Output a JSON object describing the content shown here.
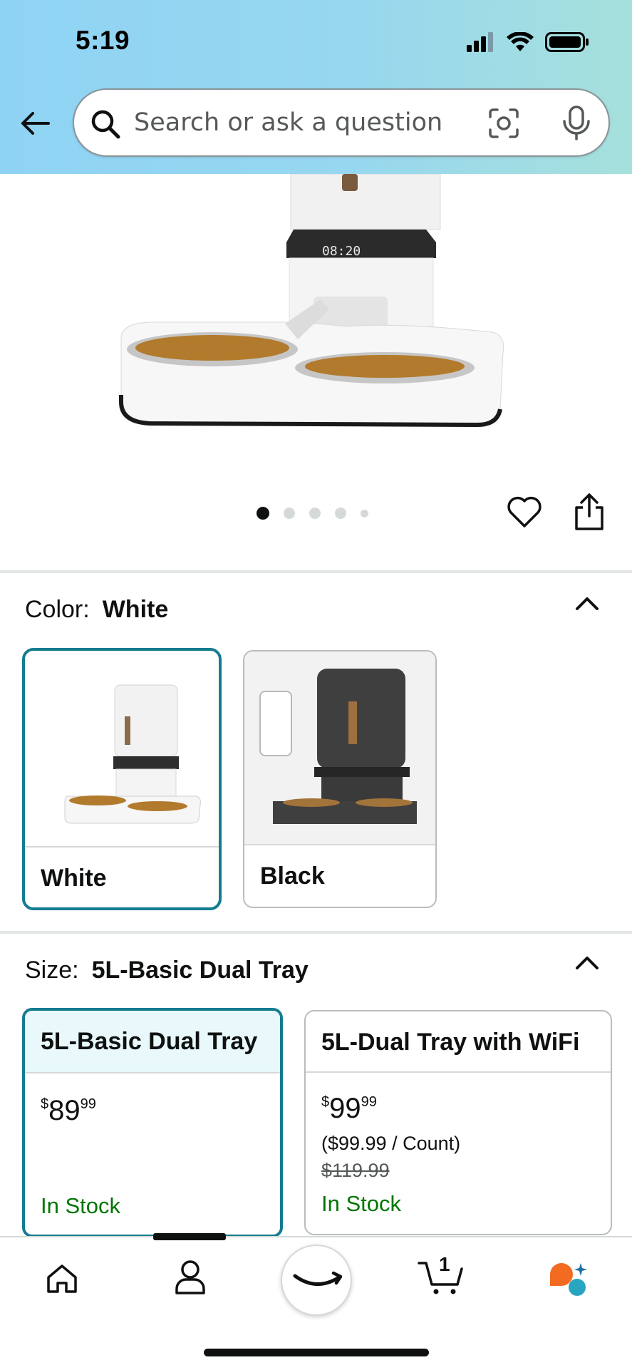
{
  "status_bar": {
    "time": "5:19"
  },
  "search": {
    "placeholder": "Search or ask a question"
  },
  "carousel": {
    "total_images": 5,
    "active_index": 0
  },
  "color": {
    "label": "Color:",
    "selected": "White",
    "options": [
      {
        "name": "White",
        "selected": true
      },
      {
        "name": "Black",
        "selected": false
      }
    ]
  },
  "size": {
    "label": "Size:",
    "selected": "5L-Basic Dual Tray",
    "options": [
      {
        "title": "5L-Basic Dual Tray",
        "price_symbol": "$",
        "price_whole": "89",
        "price_fraction": "99",
        "per_unit": "",
        "list_price": "",
        "availability": "In Stock",
        "selected": true
      },
      {
        "title": "5L-Dual Tray with WiFi",
        "price_symbol": "$",
        "price_whole": "99",
        "price_fraction": "99",
        "per_unit": "($99.99 / Count)",
        "list_price": "$119.99",
        "availability": "In Stock",
        "selected": false
      }
    ]
  },
  "bottom_nav": {
    "cart_count": "1"
  },
  "colors": {
    "accent": "#147c8f",
    "in_stock": "#007600",
    "header_start": "#8fd3f4",
    "header_end": "#a6e0dc"
  }
}
